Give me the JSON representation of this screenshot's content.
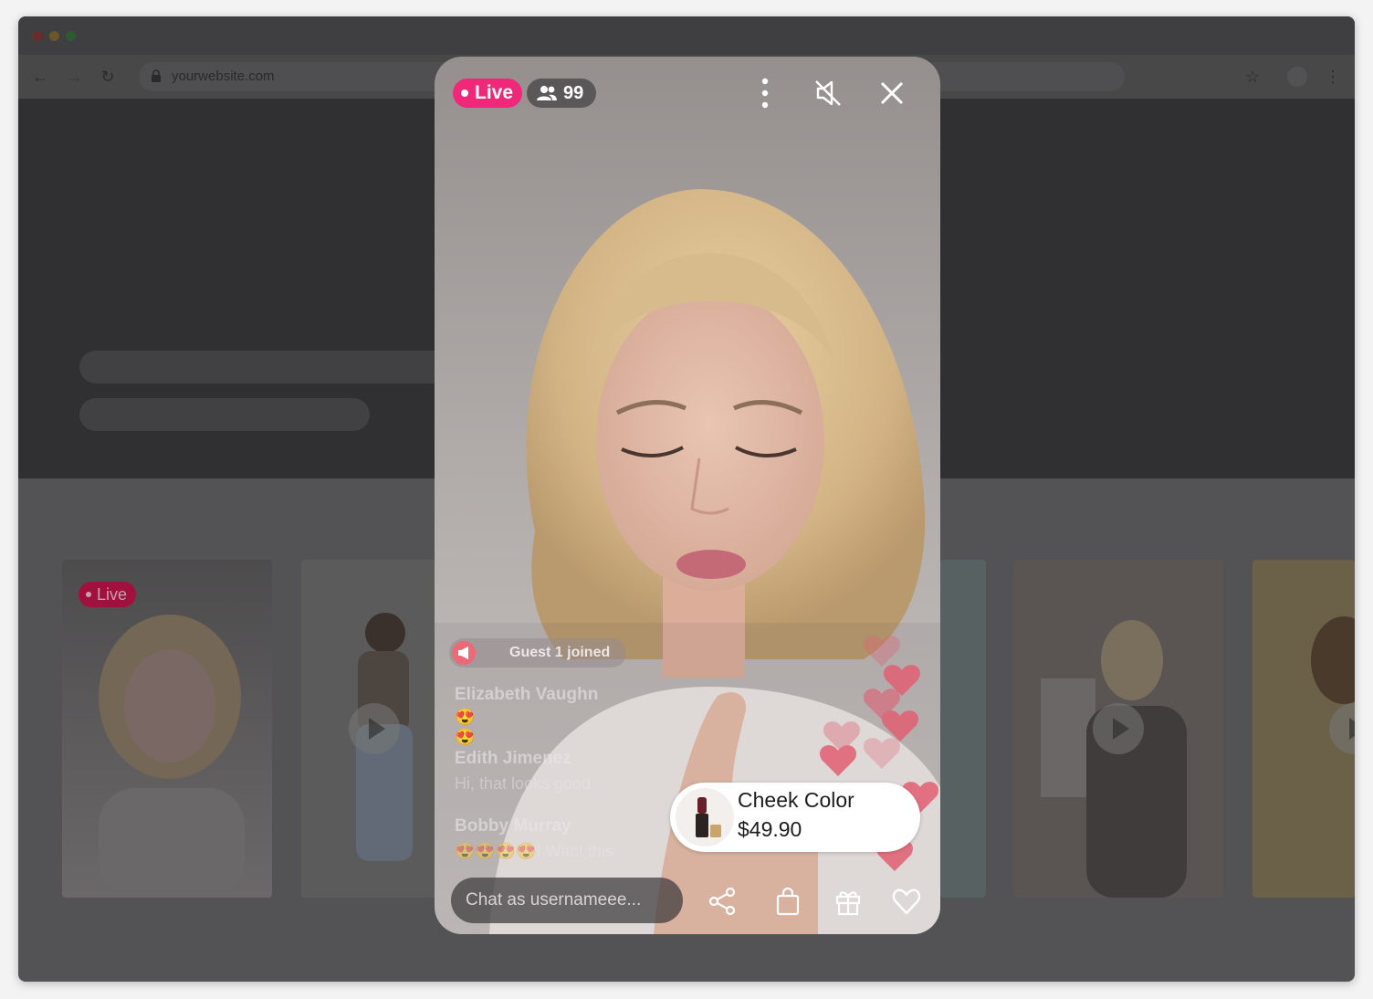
{
  "browser": {
    "url": "yourwebsite.com",
    "back_glyph": "←",
    "forward_glyph": "→",
    "reload_glyph": "↻",
    "star_glyph": "☆",
    "menu_glyph": "⋮",
    "traffic_lights": [
      "#e6524a",
      "#e5b23a",
      "#3fb950"
    ]
  },
  "thumbnails": [
    {
      "live_label": "Live",
      "icon": "none"
    },
    {
      "icon": "play-icon"
    },
    {
      "icon": "none"
    },
    {
      "icon": "play-icon"
    },
    {
      "icon": "play-icon"
    }
  ],
  "player": {
    "live_label": "Live",
    "viewer_count": "99",
    "joined_notice": "Guest 1 joined",
    "comments": [
      {
        "name": "Elizabeth Vaughn",
        "message": "😍\n😍"
      },
      {
        "name": "Edith Jimenez",
        "message": "Hi, that looks good"
      },
      {
        "name": "Bobby Murray",
        "message": "😍😍😍😍I Want this"
      }
    ],
    "product": {
      "name": "Cheek Color",
      "price": "$49.90"
    },
    "chat_placeholder": "Chat as usernameee...",
    "accent_color": "#f0287a"
  }
}
